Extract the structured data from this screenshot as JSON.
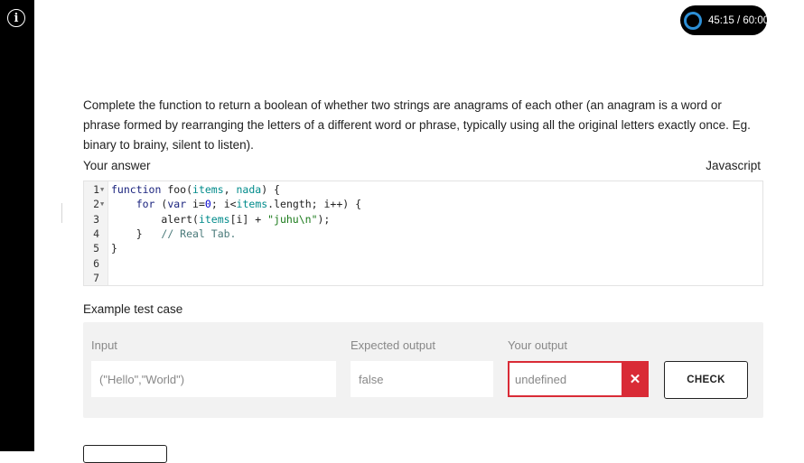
{
  "timer": {
    "text": "45:15 / 60:00",
    "ring_color": "#2d8fd6"
  },
  "question": {
    "text": "Complete the function to return a boolean of whether two strings are anagrams of each other (an anagram is a word or phrase formed by rearranging the letters of a different word or phrase, typically using all the original letters exactly once. Eg. binary to brainy, silent to listen)."
  },
  "answer": {
    "label": "Your answer",
    "language": "Javascript"
  },
  "editor": {
    "line_numbers": [
      "1",
      "2",
      "3",
      "4",
      "5",
      "6",
      "7"
    ],
    "lines": [
      "function foo(items, nada) {",
      "    for (var i=0; i<items.length; i++) {",
      "        alert(items[i] + \"juhu\\n\");",
      "    }   // Real Tab.",
      "}",
      "",
      ""
    ]
  },
  "example": {
    "label": "Example test case",
    "input_label": "Input",
    "expected_label": "Expected output",
    "your_output_label": "Your output",
    "input_value": "(\"Hello\",\"World\")",
    "expected_value": "false",
    "your_output_value": "undefined",
    "error_color": "#d92b36",
    "check_label": "CHECK"
  }
}
